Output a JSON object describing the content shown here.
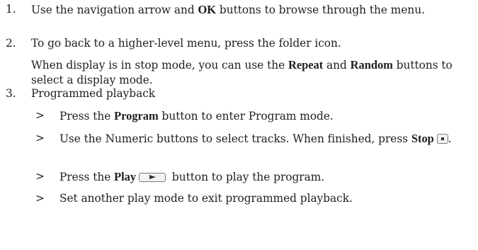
{
  "steps": [
    {
      "number": "1.",
      "text_a": "Use the navigation arrow and ",
      "bold_a": "OK",
      "text_b": " buttons to browse through the menu."
    },
    {
      "number": "2.",
      "text": "To go back to a higher-level menu, press the folder icon.",
      "note_a": "When display is in stop mode, you can use the ",
      "note_bold_a": "Repeat",
      "note_b": " and ",
      "note_bold_b": "Random",
      "note_c": " buttons to select a display mode."
    },
    {
      "number": "3.",
      "text": "Programmed playback",
      "subitems": [
        {
          "marker": ">",
          "text_a": "Press the ",
          "bold_a": "Program",
          "text_b": " button to enter Program mode."
        },
        {
          "marker": ">",
          "text_a": "Use the Numeric buttons to select tracks. When finished, press ",
          "bold_a": "Stop",
          "text_b": ".",
          "icon": "stop-button-icon"
        },
        {
          "marker": ">",
          "text_a": "Press the ",
          "bold_a": "Play",
          "text_b": " button to play the program.",
          "icon": "play-button-icon"
        },
        {
          "marker": ">",
          "text_a": "Set another play mode to exit programmed playback."
        }
      ]
    }
  ]
}
